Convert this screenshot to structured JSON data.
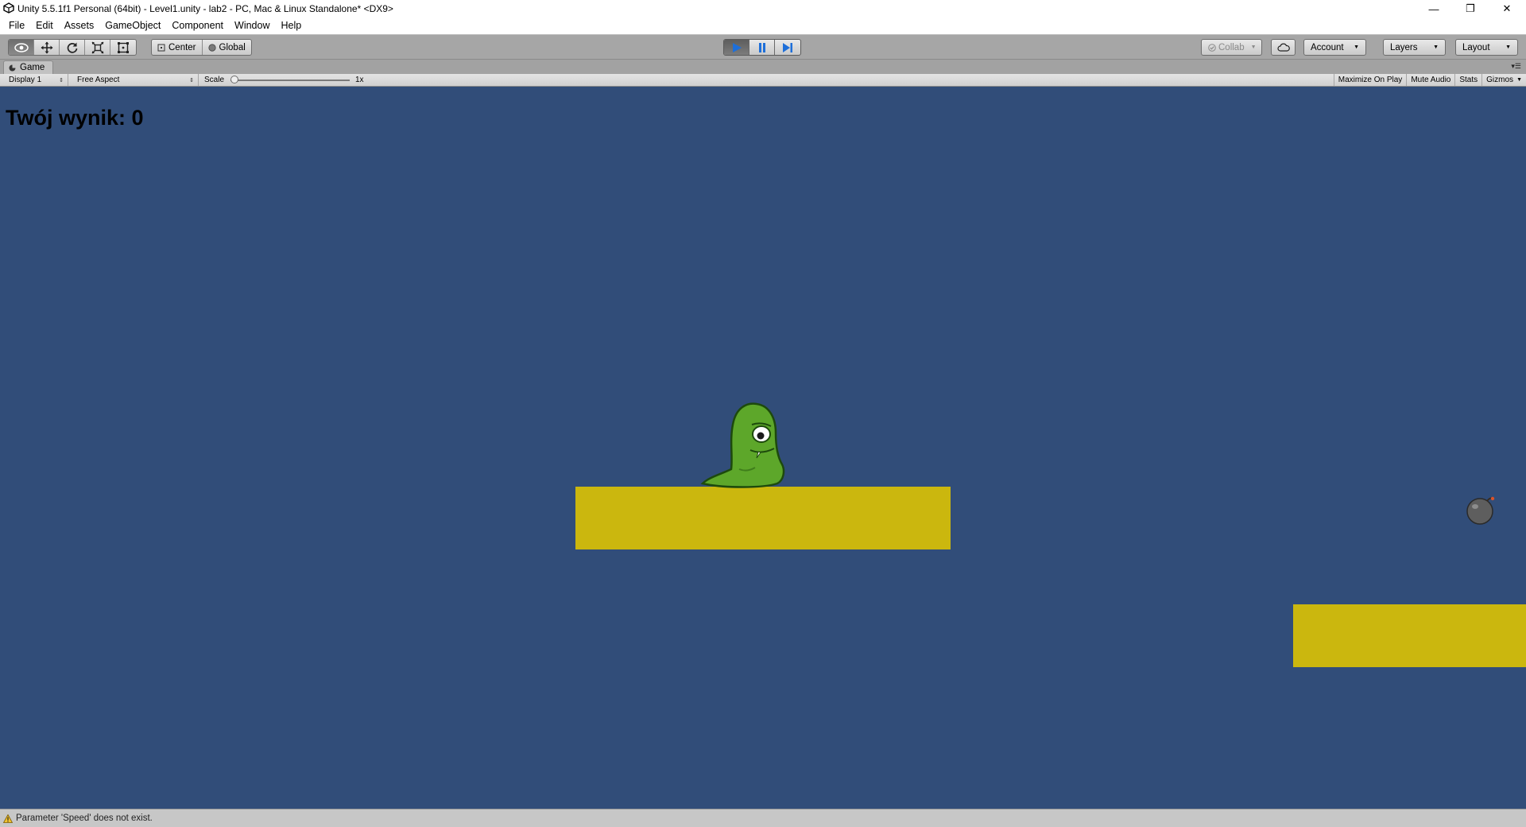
{
  "window": {
    "title": "Unity 5.5.1f1 Personal (64bit) - Level1.unity - lab2 - PC, Mac & Linux Standalone* <DX9>",
    "minimize_glyph": "—",
    "restore_glyph": "❐",
    "close_glyph": "✕"
  },
  "menubar": {
    "items": [
      "File",
      "Edit",
      "Assets",
      "GameObject",
      "Component",
      "Window",
      "Help"
    ]
  },
  "toolbar": {
    "transform_tools": [
      "hand-tool-icon",
      "move-tool-icon",
      "rotate-tool-icon",
      "scale-tool-icon",
      "rect-tool-icon"
    ],
    "active_tool": "hand-tool-icon",
    "pivot_label": "Center",
    "space_label": "Global",
    "play_state": "playing",
    "collab_label": "Collab",
    "account_label": "Account",
    "layers_label": "Layers",
    "layout_label": "Layout",
    "accent_color": "#1e6fd9"
  },
  "game_view": {
    "tab_label": "Game",
    "display_label": "Display 1",
    "aspect_label": "Free Aspect",
    "scale_label": "Scale",
    "scale_value": "1x",
    "scale_fraction": 0.0,
    "toggles": [
      "Maximize On Play",
      "Mute Audio",
      "Stats",
      "Gizmos"
    ]
  },
  "game": {
    "score_text": "Twój wynik: 0",
    "background_color": "#314d79",
    "platform_color": "#cbb70e",
    "player_color": "#5da72a"
  },
  "status": {
    "message": "Parameter 'Speed' does not exist."
  }
}
